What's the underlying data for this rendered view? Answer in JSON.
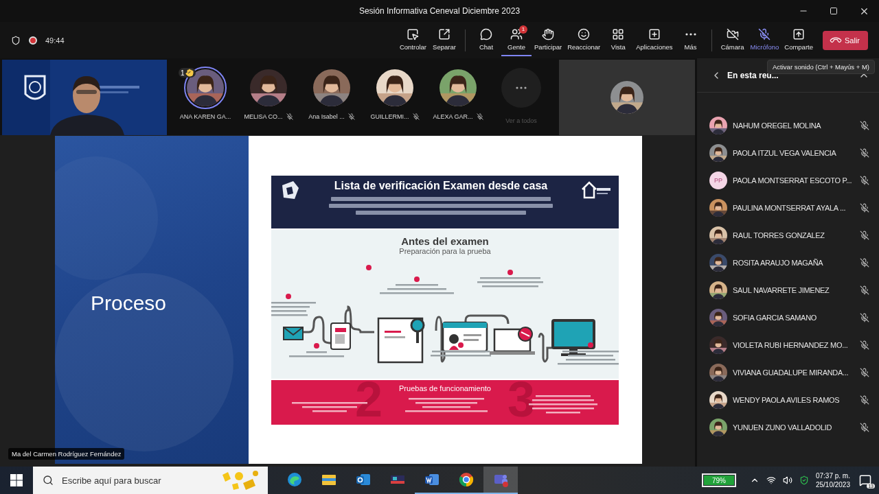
{
  "window": {
    "title": "Sesión Informativa Ceneval Diciembre 2023"
  },
  "meeting_bar": {
    "recording": true,
    "timer": "49:44",
    "share_actions": [
      {
        "kind": "control",
        "label": "Controlar",
        "selected": false,
        "highlighted": false
      },
      {
        "kind": "popout",
        "label": "Separar",
        "selected": false,
        "highlighted": false
      }
    ],
    "main_actions": [
      {
        "kind": "chat",
        "label": "Chat",
        "selected": false,
        "highlighted": false
      },
      {
        "kind": "people",
        "label": "Gente",
        "selected": true,
        "highlighted": false,
        "badge": "1"
      },
      {
        "kind": "hand",
        "label": "Participar",
        "selected": false,
        "highlighted": false
      },
      {
        "kind": "react",
        "label": "Reaccionar",
        "selected": false,
        "highlighted": false
      },
      {
        "kind": "view",
        "label": "Vista",
        "selected": false,
        "highlighted": false
      },
      {
        "kind": "apps",
        "label": "Aplicaciones",
        "selected": false,
        "highlighted": false
      },
      {
        "kind": "more",
        "label": "Más",
        "selected": false,
        "highlighted": false
      }
    ],
    "device_actions": [
      {
        "kind": "camera",
        "label": "Cámara",
        "selected": false,
        "highlighted": false
      },
      {
        "kind": "mic",
        "label": "Micrófono",
        "selected": false,
        "highlighted": true
      },
      {
        "kind": "share",
        "label": "Comparte",
        "selected": false,
        "highlighted": false
      }
    ],
    "leave": {
      "label": "Salir"
    }
  },
  "gallery": {
    "participants": [
      {
        "name": "ANA KAREN GA...",
        "speaking": true,
        "hand_raised": true,
        "hand_count": "1",
        "muted": false
      },
      {
        "name": "MELISA CO...",
        "speaking": false,
        "hand_raised": false,
        "muted": true
      },
      {
        "name": "Ana Isabel ...",
        "speaking": false,
        "hand_raised": false,
        "muted": true
      },
      {
        "name": "GUILLERMI...",
        "speaking": false,
        "hand_raised": false,
        "muted": true
      },
      {
        "name": "ALEXA GAR...",
        "speaking": false,
        "hand_raised": false,
        "muted": true
      }
    ],
    "overflow": {
      "label": "Ver a todos"
    }
  },
  "stage": {
    "slide": {
      "title": "Proceso",
      "infographic": {
        "title": "Lista de verificación Examen desde casa",
        "section": "Antes del examen",
        "subtitle": "Preparación para la prueba",
        "footer_title": "Pruebas de funcionamiento",
        "footer_numbers": [
          "2",
          "3"
        ]
      }
    },
    "presenter_label": "Ma del Carmen Rodríguez Fernández"
  },
  "people_panel": {
    "header": "En esta reu...",
    "tooltip": "Activar sonido (Ctrl + Mayús + M)",
    "people": [
      {
        "name": "NAHUM OREGEL MOLINA",
        "muted": true
      },
      {
        "name": "PAOLA ITZUL VEGA VALENCIA",
        "muted": true
      },
      {
        "name": "PAOLA MONTSERRAT ESCOTO P...",
        "kind": "initials",
        "initials": "PP",
        "muted": true
      },
      {
        "name": "PAULINA MONTSERRAT AYALA ...",
        "muted": true
      },
      {
        "name": "RAUL TORRES GONZALEZ",
        "muted": true
      },
      {
        "name": "ROSITA ARAUJO MAGAÑA",
        "muted": true
      },
      {
        "name": "SAUL NAVARRETE JIMENEZ",
        "muted": true
      },
      {
        "name": "SOFIA GARCIA SAMANO",
        "muted": true
      },
      {
        "name": "VIOLETA RUBI HERNANDEZ MO...",
        "muted": true
      },
      {
        "name": "VIVIANA GUADALUPE MIRANDA...",
        "muted": true
      },
      {
        "name": "WENDY PAOLA AVILES RAMOS",
        "muted": true
      },
      {
        "name": "YUNUEN ZUNO VALLADOLID",
        "muted": true
      }
    ]
  },
  "taskbar": {
    "search": {
      "placeholder": "Escribe aquí para buscar"
    },
    "apps": [
      {
        "kind": "edge",
        "running": false,
        "selected": false
      },
      {
        "kind": "explorer",
        "running": false,
        "selected": false
      },
      {
        "kind": "outlook",
        "running": false,
        "selected": false
      },
      {
        "kind": "media",
        "running": false,
        "selected": false
      },
      {
        "kind": "word",
        "running": true,
        "selected": false
      },
      {
        "kind": "chrome",
        "running": true,
        "selected": false
      },
      {
        "kind": "teams",
        "running": true,
        "selected": true
      }
    ],
    "battery": "79%",
    "time": "07:37 p. m.",
    "date": "25/10/2023",
    "notifications": "13"
  }
}
